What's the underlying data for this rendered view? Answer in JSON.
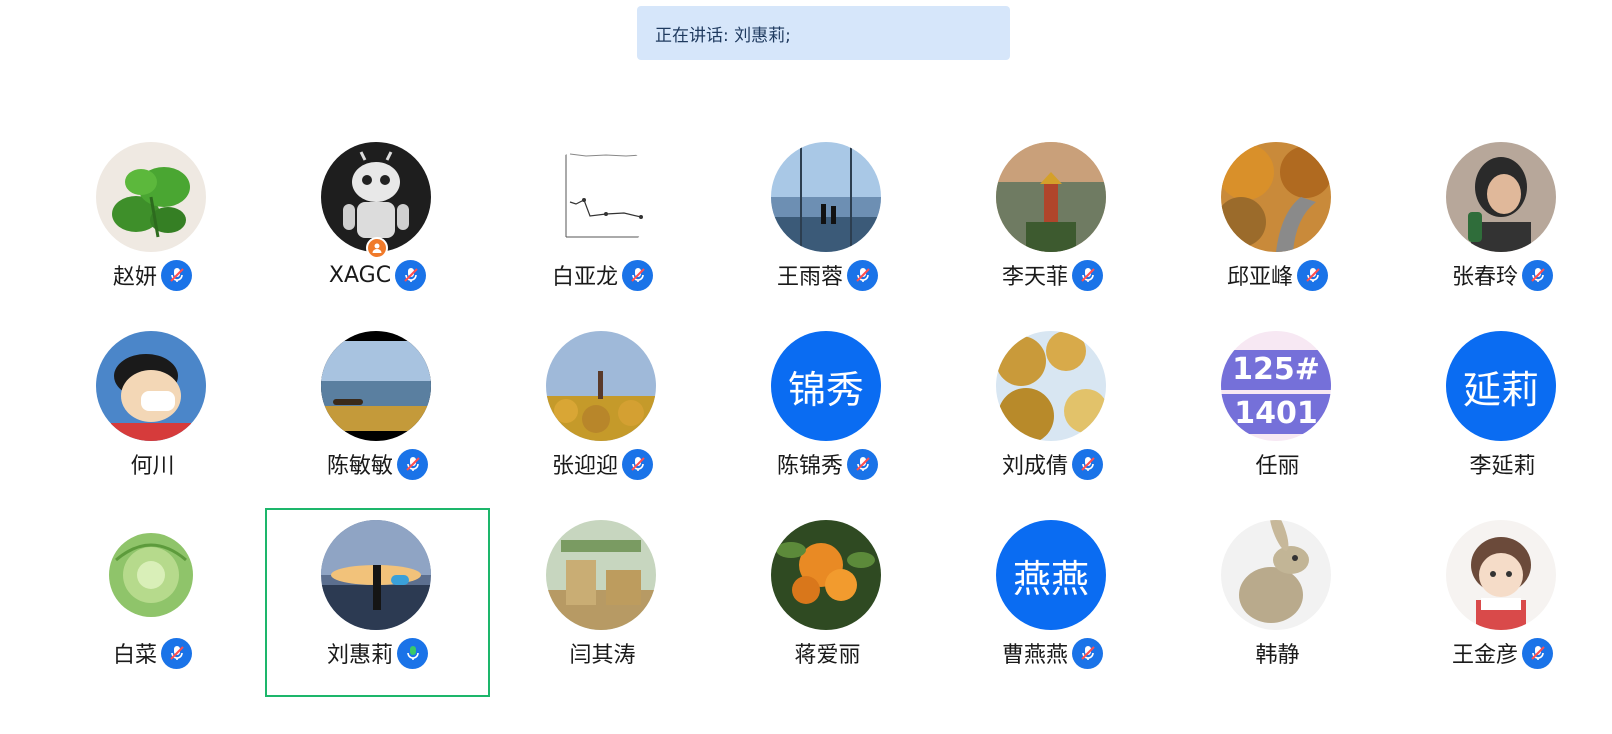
{
  "speaking": {
    "label": "正在讲话: 刘惠莉;"
  },
  "rows": [
    [
      {
        "name": "赵妍",
        "avatar": "photo",
        "mic": "muted"
      },
      {
        "name": "XAGC",
        "avatar": "photo",
        "mic": "muted",
        "host_badge": true
      },
      {
        "name": "白亚龙",
        "avatar": "photo",
        "mic": "muted"
      },
      {
        "name": "王雨蓉",
        "avatar": "photo",
        "mic": "muted"
      },
      {
        "name": "李天菲",
        "avatar": "photo",
        "mic": "muted"
      },
      {
        "name": "邱亚峰",
        "avatar": "photo",
        "mic": "muted"
      },
      {
        "name": "张春玲",
        "avatar": "photo",
        "mic": "muted"
      }
    ],
    [
      {
        "name": "何川",
        "avatar": "photo",
        "mic": "none"
      },
      {
        "name": "陈敏敏",
        "avatar": "photo",
        "mic": "muted"
      },
      {
        "name": "张迎迎",
        "avatar": "photo",
        "mic": "muted"
      },
      {
        "name": "陈锦秀",
        "avatar": "text",
        "avatar_text": "锦秀",
        "mic": "muted"
      },
      {
        "name": "刘成倩",
        "avatar": "photo",
        "mic": "muted"
      },
      {
        "name": "任丽",
        "avatar": "photo",
        "avatar_text": "125#\n1401",
        "mic": "none"
      },
      {
        "name": "李延莉",
        "avatar": "text",
        "avatar_text": "延莉",
        "mic": "none"
      }
    ],
    [
      {
        "name": "白菜",
        "avatar": "photo",
        "mic": "muted"
      },
      {
        "name": "刘惠莉",
        "avatar": "photo",
        "mic": "speaking",
        "selected": true
      },
      {
        "name": "闫其涛",
        "avatar": "photo",
        "mic": "none"
      },
      {
        "name": "蒋爱丽",
        "avatar": "photo",
        "mic": "none"
      },
      {
        "name": "曹燕燕",
        "avatar": "text",
        "avatar_text": "燕燕",
        "mic": "muted"
      },
      {
        "name": "韩静",
        "avatar": "photo",
        "mic": "none"
      },
      {
        "name": "王金彦",
        "avatar": "photo",
        "mic": "muted"
      }
    ]
  ],
  "colors": {
    "accent": "#1a73e8",
    "text_avatar_bg": "#0a6cf2",
    "selected_border": "#1db66b",
    "speaking_mic": "#39c86a",
    "banner_bg": "#d6e6fa",
    "host_badge": "#f07a2a"
  }
}
